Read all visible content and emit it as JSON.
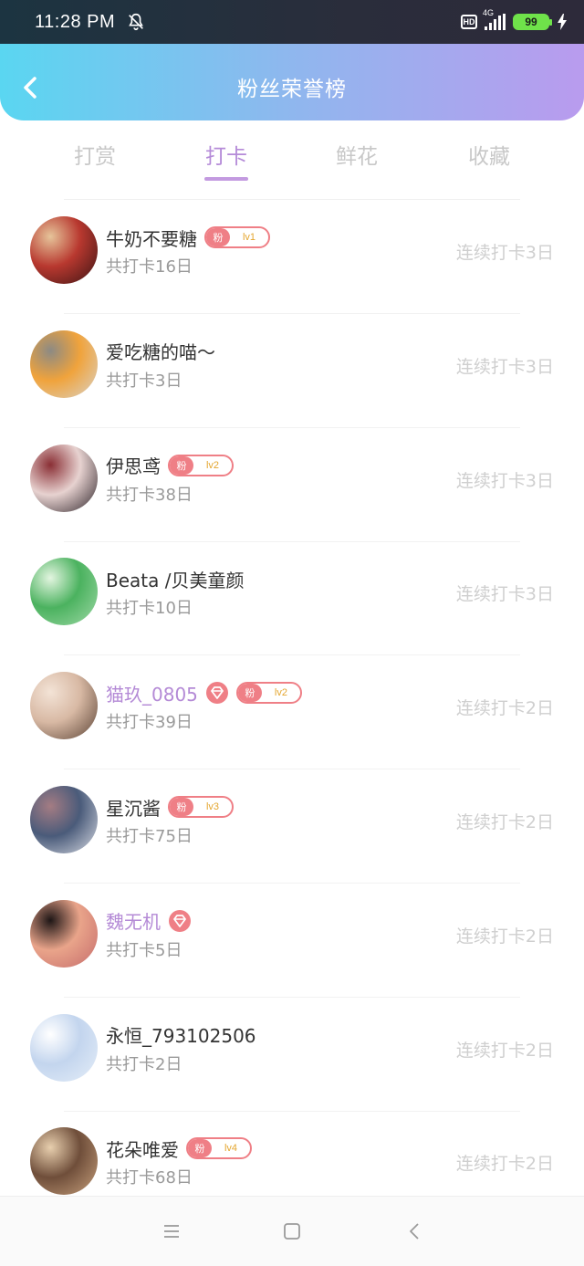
{
  "status_bar": {
    "time": "11:28 PM",
    "hd_label": "HD",
    "network_label": "4G",
    "battery_level": "99",
    "icons": [
      "bell-muted-icon",
      "hd-icon",
      "signal-icon",
      "battery-icon",
      "charging-bolt-icon"
    ]
  },
  "header": {
    "title": "粉丝荣誉榜",
    "back_icon": "chevron-left-icon"
  },
  "tabs": [
    {
      "label": "打赏",
      "active": false
    },
    {
      "label": "打卡",
      "active": true
    },
    {
      "label": "鲜花",
      "active": false
    },
    {
      "label": "收藏",
      "active": false
    }
  ],
  "fans": [
    {
      "name": "牛奶不要糖",
      "vip": false,
      "diamond": false,
      "fan_badge": {
        "char": "粉",
        "level": "lv1"
      },
      "total": "共打卡16日",
      "streak": "连续打卡3日",
      "avatar_colors": [
        "#3a1414",
        "#b8382f",
        "#e6c49a"
      ]
    },
    {
      "name": "爱吃糖的喵～",
      "vip": false,
      "diamond": false,
      "fan_badge": null,
      "total": "共打卡3日",
      "streak": "连续打卡3日",
      "avatar_colors": [
        "#d9d3c9",
        "#f0a33c",
        "#8c8a84"
      ]
    },
    {
      "name": "伊思鸢",
      "vip": false,
      "diamond": false,
      "fan_badge": {
        "char": "粉",
        "level": "lv2"
      },
      "total": "共打卡38日",
      "streak": "连续打卡3日",
      "avatar_colors": [
        "#2c2228",
        "#e7d2d0",
        "#8a2f35"
      ]
    },
    {
      "name": "Beata /贝美童颜",
      "vip": false,
      "diamond": false,
      "fan_badge": null,
      "total": "共打卡10日",
      "streak": "连续打卡3日",
      "avatar_colors": [
        "#9fd9a6",
        "#4bb25f",
        "#e3f5e0"
      ]
    },
    {
      "name": "猫玖_0805",
      "vip": true,
      "diamond": true,
      "fan_badge": {
        "char": "粉",
        "level": "lv2"
      },
      "total": "共打卡39日",
      "streak": "连续打卡2日",
      "avatar_colors": [
        "#5a4234",
        "#d8b9a4",
        "#f3e3d6"
      ]
    },
    {
      "name": "星沉酱",
      "vip": false,
      "diamond": false,
      "fan_badge": {
        "char": "粉",
        "level": "lv3"
      },
      "total": "共打卡75日",
      "streak": "连续打卡2日",
      "avatar_colors": [
        "#d9dce4",
        "#4a5b7a",
        "#a47c83"
      ]
    },
    {
      "name": "魏无机",
      "vip": true,
      "diamond": true,
      "fan_badge": null,
      "total": "共打卡5日",
      "streak": "连续打卡2日",
      "avatar_colors": [
        "#c56b6b",
        "#e9a48a",
        "#1e1616"
      ]
    },
    {
      "name": "永恒_793102506",
      "vip": false,
      "diamond": false,
      "fan_badge": null,
      "total": "共打卡2日",
      "streak": "连续打卡2日",
      "avatar_colors": [
        "#e5eef8",
        "#c3d5ee",
        "#ffffff"
      ]
    },
    {
      "name": "花朵唯爱",
      "vip": false,
      "diamond": false,
      "fan_badge": {
        "char": "粉",
        "level": "lv4"
      },
      "total": "共打卡68日",
      "streak": "连续打卡2日",
      "avatar_colors": [
        "#c7a07c",
        "#6f4e3a",
        "#e8cfae"
      ]
    }
  ],
  "nav_bar": {
    "icons": [
      "menu-icon",
      "home-square-icon",
      "back-triangle-icon"
    ]
  }
}
